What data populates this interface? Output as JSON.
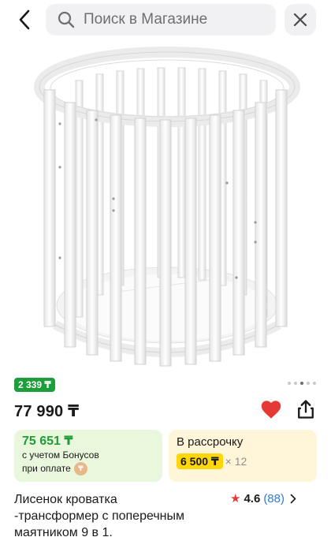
{
  "header": {
    "search_placeholder": "Поиск в Магазине"
  },
  "gallery": {
    "total": 5,
    "active_index": 3
  },
  "product": {
    "bonus_badge": "2 339 ₸",
    "price": "77 990 ₸",
    "title": "Лисенок кроватка\n-трансформер с поперечным\nмаятником 9 в 1.",
    "rating": {
      "value": "4.6",
      "count": "(88)"
    },
    "favorited": true
  },
  "offers": {
    "bonus": {
      "amount": "75 651 ₸",
      "line1": "с учетом Бонусов",
      "line2": "при оплате"
    },
    "installment": {
      "title": "В рассрочку",
      "amount": "6 500 ₸",
      "months": "× 12"
    }
  },
  "colors": {
    "accent_green": "#1e9e3a",
    "heart_red": "#e53935",
    "link_blue": "#2f7be0",
    "installment_yellow": "#ffd60a"
  }
}
